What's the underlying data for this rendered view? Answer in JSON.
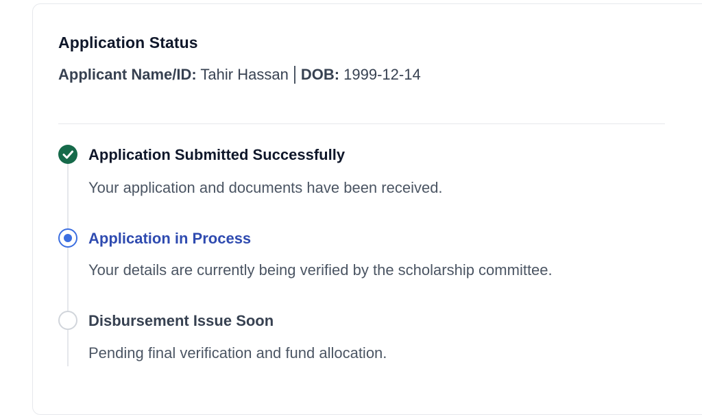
{
  "header": {
    "title": "Application Status",
    "applicant_label": "Applicant Name/ID:",
    "applicant_value": "Tahir Hassan",
    "dob_label": "DOB:",
    "dob_value": "1999-12-14"
  },
  "steps": [
    {
      "title": "Application Submitted Successfully",
      "description": "Your application and documents have been received.",
      "status": "completed",
      "icon": "check-circle-icon",
      "color": "#166a4a"
    },
    {
      "title": "Application in Process",
      "description": "Your details are currently being verified by the scholarship committee.",
      "status": "in-progress",
      "icon": "radio-dot-icon",
      "color": "#2f4bb0"
    },
    {
      "title": "Disbursement Issue Soon",
      "description": "Pending final verification and fund allocation.",
      "status": "pending",
      "icon": "empty-circle-icon",
      "color": "#d1d5db"
    }
  ]
}
